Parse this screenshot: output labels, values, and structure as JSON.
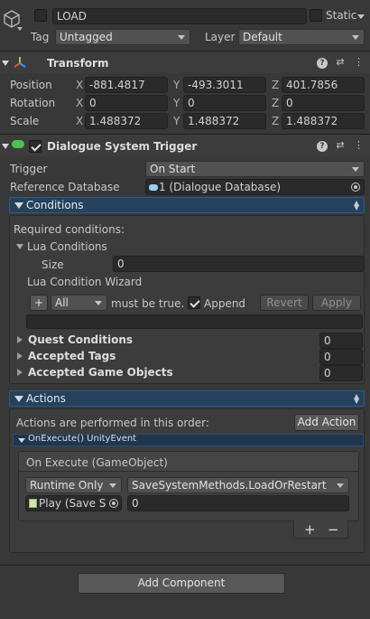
{
  "gameobject": {
    "name": "LOAD",
    "static_label": "Static",
    "tag_label": "Tag",
    "tag_value": "Untagged",
    "layer_label": "Layer",
    "layer_value": "Default"
  },
  "transform": {
    "title": "Transform",
    "position_label": "Position",
    "rotation_label": "Rotation",
    "scale_label": "Scale",
    "axis_x": "X",
    "axis_y": "Y",
    "axis_z": "Z",
    "position": {
      "x": "-881.4817",
      "y": "-493.3011",
      "z": "401.7856"
    },
    "rotation": {
      "x": "0",
      "y": "0",
      "z": "0"
    },
    "scale": {
      "x": "1.488372",
      "y": "1.488372",
      "z": "1.488372"
    }
  },
  "trigger_component": {
    "title": "Dialogue System Trigger",
    "trigger_label": "Trigger",
    "trigger_value": "On Start",
    "ref_db_label": "Reference Database",
    "ref_db_value": "1 (Dialogue Database)"
  },
  "conditions": {
    "header": "Conditions",
    "required_label": "Required conditions:",
    "lua_conditions_label": "Lua Conditions",
    "size_label": "Size",
    "size_value": "0",
    "wizard_label": "Lua Condition Wizard",
    "plus_label": "+",
    "all_value": "All",
    "must_be_true": "must be true.",
    "append_label": "Append",
    "revert_label": "Revert",
    "apply_label": "Apply",
    "quest_conditions_label": "Quest Conditions",
    "quest_conditions_value": "0",
    "accepted_tags_label": "Accepted Tags",
    "accepted_tags_value": "0",
    "accepted_gameobjects_label": "Accepted Game Objects",
    "accepted_gameobjects_value": "0"
  },
  "actions": {
    "header": "Actions",
    "order_text": "Actions are performed in this order:",
    "add_action_label": "Add Action",
    "unity_event_label": "OnExecute() UnityEvent",
    "on_execute_label": "On Execute (GameObject)",
    "runtime_value": "Runtime Only",
    "method_value": "SaveSystemMethods.LoadOrRestart",
    "target_value": "Play (Save S",
    "arg_value": "0",
    "plus_label": "+",
    "minus_label": "−"
  },
  "footer": {
    "add_component_label": "Add Component"
  },
  "colors": {
    "background": "#383838",
    "section_blue": "#24425e",
    "field": "#2a2a2a"
  }
}
